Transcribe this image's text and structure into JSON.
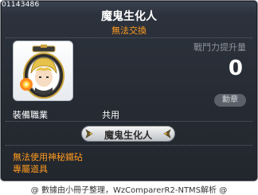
{
  "item": {
    "id": "01143486",
    "name": "魔鬼生化人",
    "trade_note": "無法交換"
  },
  "power": {
    "label": "戰鬥力提升量",
    "value": "0"
  },
  "medal_badge": "勳章",
  "requirements": {
    "job_label": "裝備職業",
    "job_value": "共用"
  },
  "title_banner": {
    "text": "魔鬼生化人"
  },
  "restrictions": [
    "無法使用神秘鐵砧",
    "專屬道具"
  ],
  "credit": "@ 數據由小冊子整理，WzComparerR2-NTMS解析 @",
  "icons": {
    "item_icon": "medal-character-icon",
    "banner_caps": "wing-ornament-icon"
  },
  "colors": {
    "background": "#262b33",
    "accent_orange": "#ff9a1f",
    "label_gray": "#8d939b"
  }
}
